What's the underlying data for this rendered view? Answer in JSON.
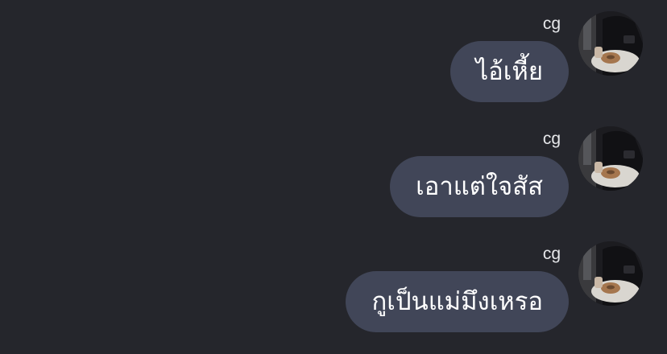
{
  "messages": [
    {
      "sender": "cg",
      "text": "ไอ้เหี้ย"
    },
    {
      "sender": "cg",
      "text": "เอาแต่ใจสัส"
    },
    {
      "sender": "cg",
      "text": "กูเป็นแม่มึงเหรอ"
    }
  ],
  "colors": {
    "background": "#25262c",
    "bubble": "#414658",
    "bubble_text": "#ffffff",
    "sender_text": "#e6e7ea"
  },
  "icons": {
    "avatar": "user-avatar-photo"
  }
}
